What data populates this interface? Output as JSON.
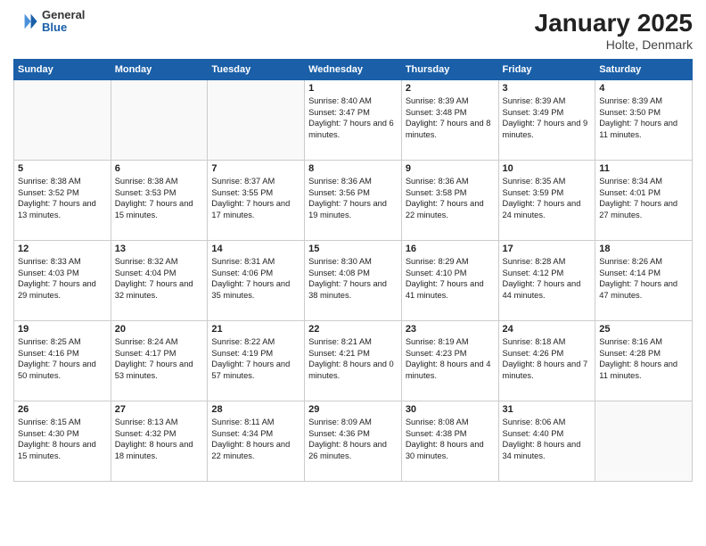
{
  "header": {
    "logo": {
      "general": "General",
      "blue": "Blue"
    },
    "title": "January 2025",
    "location": "Holte, Denmark"
  },
  "weekdays": [
    "Sunday",
    "Monday",
    "Tuesday",
    "Wednesday",
    "Thursday",
    "Friday",
    "Saturday"
  ],
  "weeks": [
    [
      {
        "day": "",
        "info": ""
      },
      {
        "day": "",
        "info": ""
      },
      {
        "day": "",
        "info": ""
      },
      {
        "day": "1",
        "info": "Sunrise: 8:40 AM\nSunset: 3:47 PM\nDaylight: 7 hours\nand 6 minutes."
      },
      {
        "day": "2",
        "info": "Sunrise: 8:39 AM\nSunset: 3:48 PM\nDaylight: 7 hours\nand 8 minutes."
      },
      {
        "day": "3",
        "info": "Sunrise: 8:39 AM\nSunset: 3:49 PM\nDaylight: 7 hours\nand 9 minutes."
      },
      {
        "day": "4",
        "info": "Sunrise: 8:39 AM\nSunset: 3:50 PM\nDaylight: 7 hours\nand 11 minutes."
      }
    ],
    [
      {
        "day": "5",
        "info": "Sunrise: 8:38 AM\nSunset: 3:52 PM\nDaylight: 7 hours\nand 13 minutes."
      },
      {
        "day": "6",
        "info": "Sunrise: 8:38 AM\nSunset: 3:53 PM\nDaylight: 7 hours\nand 15 minutes."
      },
      {
        "day": "7",
        "info": "Sunrise: 8:37 AM\nSunset: 3:55 PM\nDaylight: 7 hours\nand 17 minutes."
      },
      {
        "day": "8",
        "info": "Sunrise: 8:36 AM\nSunset: 3:56 PM\nDaylight: 7 hours\nand 19 minutes."
      },
      {
        "day": "9",
        "info": "Sunrise: 8:36 AM\nSunset: 3:58 PM\nDaylight: 7 hours\nand 22 minutes."
      },
      {
        "day": "10",
        "info": "Sunrise: 8:35 AM\nSunset: 3:59 PM\nDaylight: 7 hours\nand 24 minutes."
      },
      {
        "day": "11",
        "info": "Sunrise: 8:34 AM\nSunset: 4:01 PM\nDaylight: 7 hours\nand 27 minutes."
      }
    ],
    [
      {
        "day": "12",
        "info": "Sunrise: 8:33 AM\nSunset: 4:03 PM\nDaylight: 7 hours\nand 29 minutes."
      },
      {
        "day": "13",
        "info": "Sunrise: 8:32 AM\nSunset: 4:04 PM\nDaylight: 7 hours\nand 32 minutes."
      },
      {
        "day": "14",
        "info": "Sunrise: 8:31 AM\nSunset: 4:06 PM\nDaylight: 7 hours\nand 35 minutes."
      },
      {
        "day": "15",
        "info": "Sunrise: 8:30 AM\nSunset: 4:08 PM\nDaylight: 7 hours\nand 38 minutes."
      },
      {
        "day": "16",
        "info": "Sunrise: 8:29 AM\nSunset: 4:10 PM\nDaylight: 7 hours\nand 41 minutes."
      },
      {
        "day": "17",
        "info": "Sunrise: 8:28 AM\nSunset: 4:12 PM\nDaylight: 7 hours\nand 44 minutes."
      },
      {
        "day": "18",
        "info": "Sunrise: 8:26 AM\nSunset: 4:14 PM\nDaylight: 7 hours\nand 47 minutes."
      }
    ],
    [
      {
        "day": "19",
        "info": "Sunrise: 8:25 AM\nSunset: 4:16 PM\nDaylight: 7 hours\nand 50 minutes."
      },
      {
        "day": "20",
        "info": "Sunrise: 8:24 AM\nSunset: 4:17 PM\nDaylight: 7 hours\nand 53 minutes."
      },
      {
        "day": "21",
        "info": "Sunrise: 8:22 AM\nSunset: 4:19 PM\nDaylight: 7 hours\nand 57 minutes."
      },
      {
        "day": "22",
        "info": "Sunrise: 8:21 AM\nSunset: 4:21 PM\nDaylight: 8 hours\nand 0 minutes."
      },
      {
        "day": "23",
        "info": "Sunrise: 8:19 AM\nSunset: 4:23 PM\nDaylight: 8 hours\nand 4 minutes."
      },
      {
        "day": "24",
        "info": "Sunrise: 8:18 AM\nSunset: 4:26 PM\nDaylight: 8 hours\nand 7 minutes."
      },
      {
        "day": "25",
        "info": "Sunrise: 8:16 AM\nSunset: 4:28 PM\nDaylight: 8 hours\nand 11 minutes."
      }
    ],
    [
      {
        "day": "26",
        "info": "Sunrise: 8:15 AM\nSunset: 4:30 PM\nDaylight: 8 hours\nand 15 minutes."
      },
      {
        "day": "27",
        "info": "Sunrise: 8:13 AM\nSunset: 4:32 PM\nDaylight: 8 hours\nand 18 minutes."
      },
      {
        "day": "28",
        "info": "Sunrise: 8:11 AM\nSunset: 4:34 PM\nDaylight: 8 hours\nand 22 minutes."
      },
      {
        "day": "29",
        "info": "Sunrise: 8:09 AM\nSunset: 4:36 PM\nDaylight: 8 hours\nand 26 minutes."
      },
      {
        "day": "30",
        "info": "Sunrise: 8:08 AM\nSunset: 4:38 PM\nDaylight: 8 hours\nand 30 minutes."
      },
      {
        "day": "31",
        "info": "Sunrise: 8:06 AM\nSunset: 4:40 PM\nDaylight: 8 hours\nand 34 minutes."
      },
      {
        "day": "",
        "info": ""
      }
    ]
  ]
}
